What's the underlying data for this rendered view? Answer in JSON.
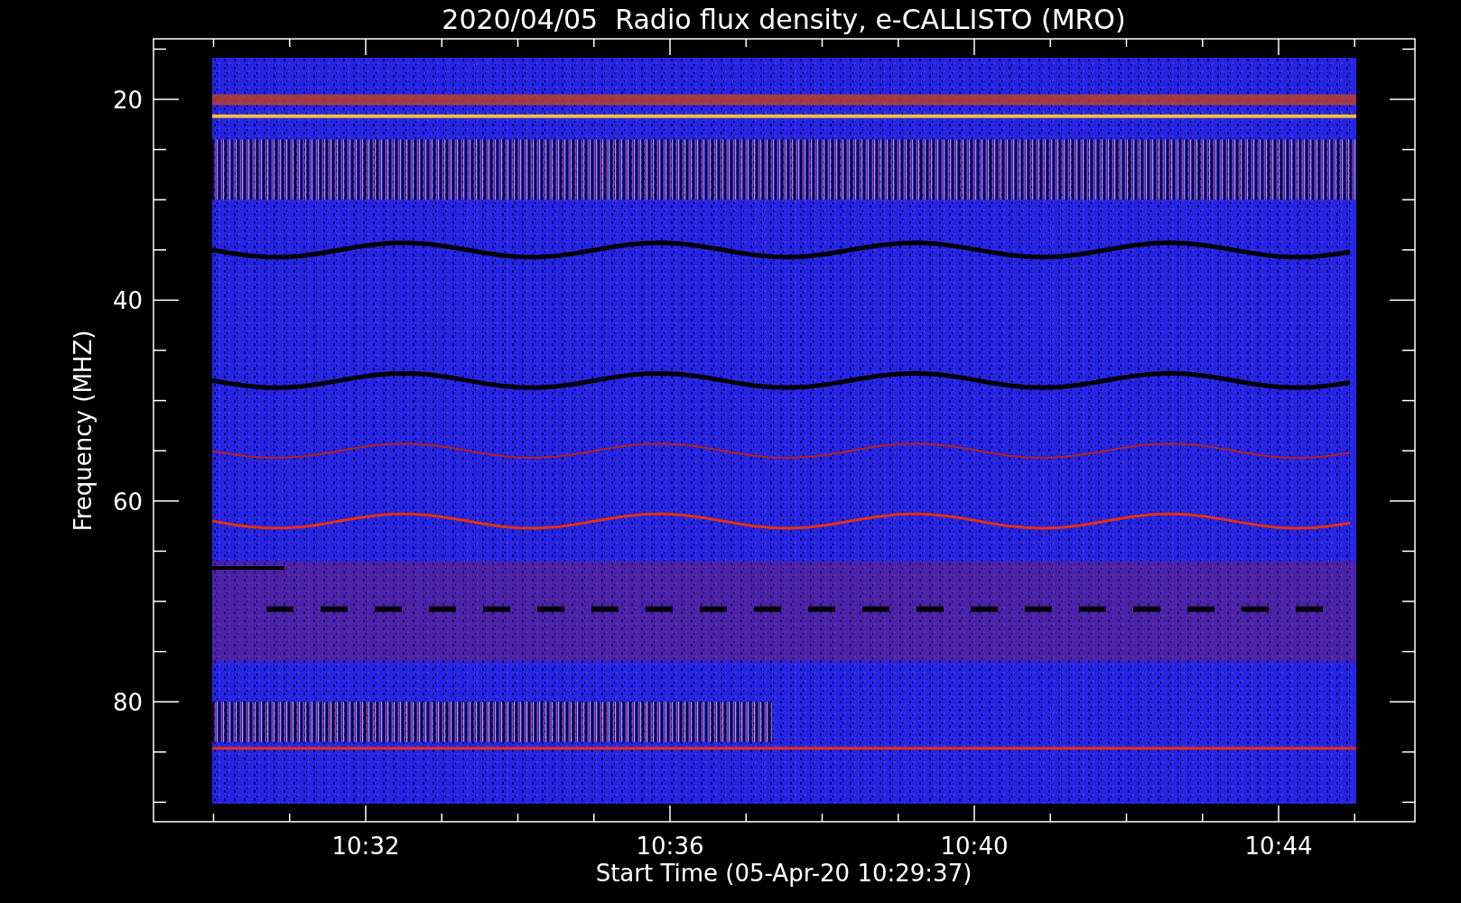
{
  "title": "2020/04/05  Radio flux density, e-CALLISTO (MRO)",
  "y_axis": {
    "label": "Frequency (MHZ)",
    "ticks": [
      "20",
      "40",
      "60",
      "80"
    ]
  },
  "x_axis": {
    "label": "Start Time (05-Apr-20 10:29:37)",
    "ticks": [
      "10:32",
      "10:36",
      "10:40",
      "10:44"
    ]
  }
}
